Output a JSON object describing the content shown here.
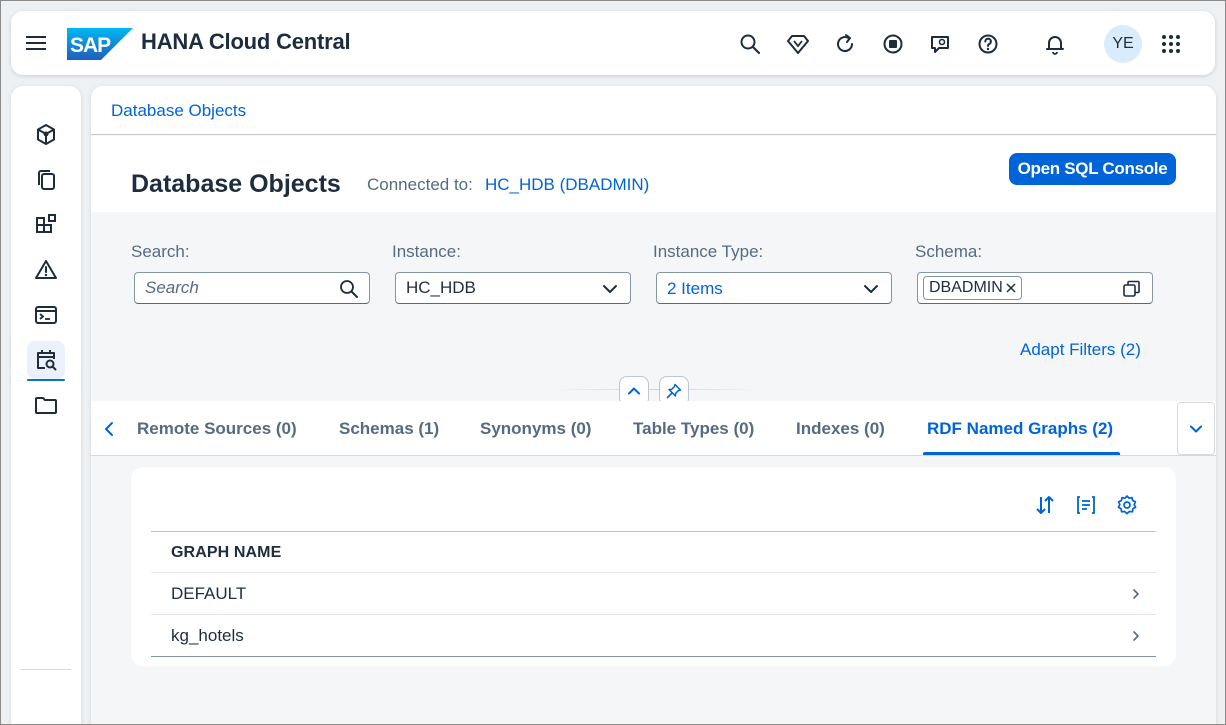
{
  "shell": {
    "title": "HANA Cloud Central",
    "avatar_initials": "YE",
    "icons": [
      "menu-icon",
      "search-icon",
      "diamond-icon",
      "refresh-icon",
      "stop-icon",
      "feedback-icon",
      "help-icon",
      "bell-icon",
      "grid-icon"
    ]
  },
  "sidenav": {
    "items": [
      "cube-icon",
      "copy-icon",
      "blocks-icon",
      "alert-icon",
      "console-icon",
      "calendar-search-icon",
      "folder-icon"
    ],
    "active_index": 5
  },
  "breadcrumb": "Database Objects",
  "header": {
    "title": "Database Objects",
    "connected_label": "Connected to:",
    "connected_value": "HC_HDB (DBADMIN)",
    "open_sql_label": "Open SQL Console"
  },
  "filters": {
    "search_label": "Search:",
    "search_placeholder": "Search",
    "instance_label": "Instance:",
    "instance_value": "HC_HDB",
    "instance_type_label": "Instance Type:",
    "instance_type_value": "2 Items",
    "schema_label": "Schema:",
    "schema_token": "DBADMIN",
    "adapt_filters": "Adapt Filters (2)"
  },
  "tabs": [
    {
      "label": "Remote Sources (0)"
    },
    {
      "label": "Schemas (1)"
    },
    {
      "label": "Synonyms (0)"
    },
    {
      "label": "Table Types (0)"
    },
    {
      "label": "Indexes (0)"
    },
    {
      "label": "RDF Named Graphs (2)",
      "selected": true
    }
  ],
  "table": {
    "column_header": "GRAPH NAME",
    "rows": [
      "DEFAULT",
      "kg_hotels"
    ],
    "tools": [
      "sort-icon",
      "group-icon",
      "settings-icon"
    ]
  },
  "colors": {
    "brand": "#0064d9",
    "text": "#1d2d3e",
    "muted": "#556b82"
  }
}
